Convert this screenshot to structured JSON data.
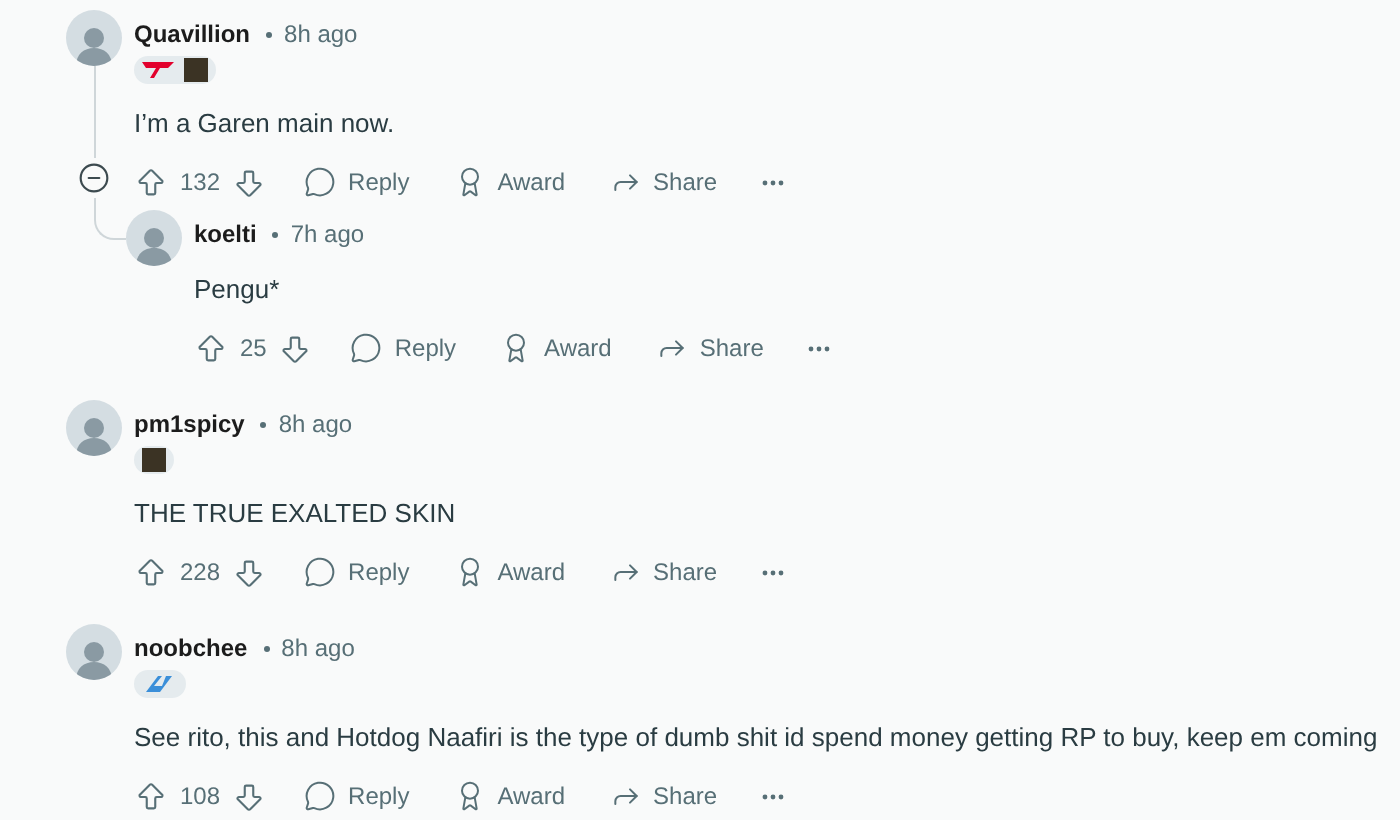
{
  "comments": [
    {
      "username": "Quavillion",
      "time": "8h ago",
      "flair": [
        {
          "kind": "team-logo"
        },
        {
          "kind": "portrait"
        }
      ],
      "body": "I’m a Garen main now.",
      "score": "132",
      "actions": [
        "Reply",
        "Award",
        "Share"
      ],
      "expanded": true,
      "children": [
        {
          "username": "koelti",
          "time": "7h ago",
          "body": "Pengu*",
          "score": "25",
          "actions": [
            "Reply",
            "Award",
            "Share"
          ]
        }
      ]
    },
    {
      "username": "pm1spicy",
      "time": "8h ago",
      "flair": [
        {
          "kind": "portrait"
        }
      ],
      "body": "THE TRUE EXALTED SKIN",
      "score": "228",
      "actions": [
        "Reply",
        "Award",
        "Share"
      ]
    },
    {
      "username": "noobchee",
      "time": "8h ago",
      "flair": [
        {
          "kind": "team-logo-alt"
        }
      ],
      "body": "See rito, this and Hotdog Naafiri is the type of dumb shit id spend money getting RP to buy, keep em coming",
      "score": "108",
      "actions": [
        "Reply",
        "Award",
        "Share"
      ]
    }
  ]
}
